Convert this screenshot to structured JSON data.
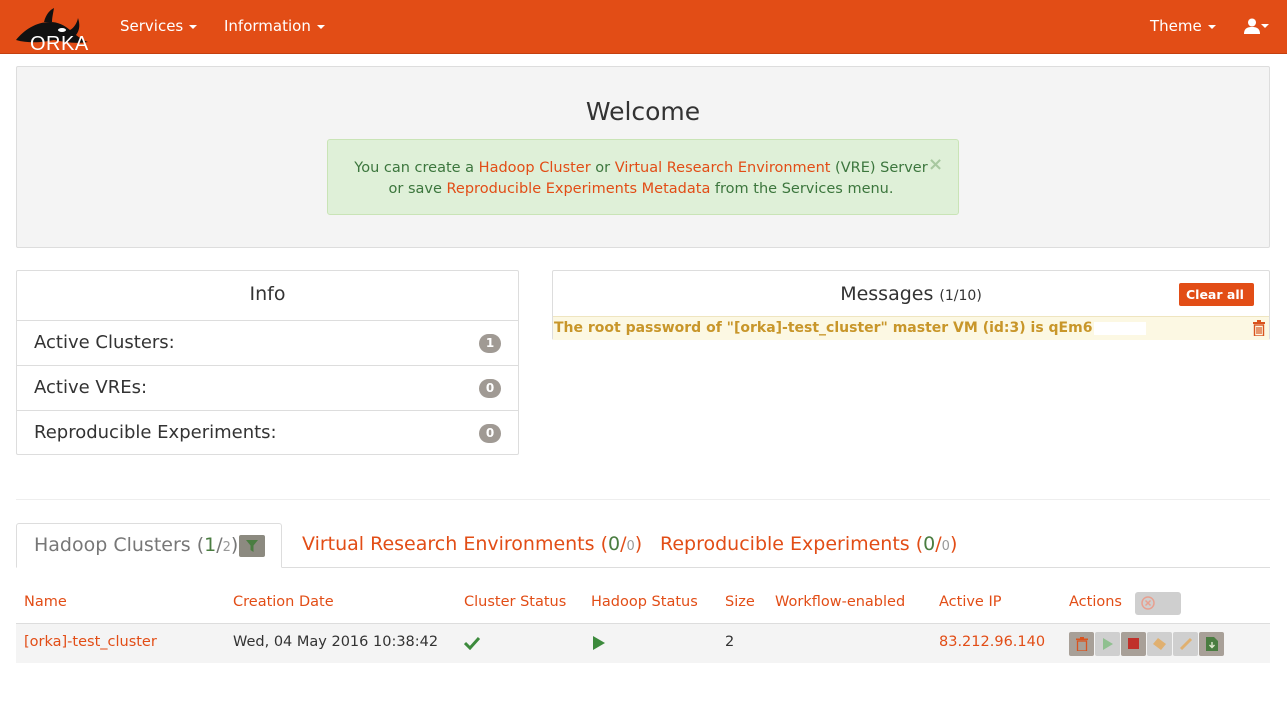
{
  "navbar": {
    "logo_text": "ORKA",
    "services_label": "Services",
    "information_label": "Information",
    "theme_label": "Theme"
  },
  "welcome": {
    "title": "Welcome",
    "alert_part1": "You can create a ",
    "alert_link1": "Hadoop Cluster",
    "alert_part2": " or ",
    "alert_link2": "Virtual Research Environment",
    "alert_part3": " (VRE) Server",
    "alert_part4": "or save ",
    "alert_link3": "Reproducible Experiments Metadata",
    "alert_part5": " from the Services menu.",
    "close_glyph": "×"
  },
  "info": {
    "title": "Info",
    "rows": [
      {
        "label": "Active Clusters:",
        "count": "1"
      },
      {
        "label": "Active VREs:",
        "count": "0"
      },
      {
        "label": "Reproducible Experiments:",
        "count": "0"
      }
    ]
  },
  "messages": {
    "title": "Messages",
    "count": "(1/10)",
    "clear_label": "Clear all",
    "items": [
      {
        "text": "The root password of \"[orka]-test_cluster\" master VM (id:3) is qEm6"
      }
    ]
  },
  "tabs": [
    {
      "label": "Hadoop Clusters (",
      "active": "1",
      "sep": "/",
      "total": "2",
      "close": ")"
    },
    {
      "label": "Virtual Research Environments (",
      "active": "0",
      "sep": "/",
      "total": "0",
      "close": ")"
    },
    {
      "label": "Reproducible Experiments (",
      "active": "0",
      "sep": "/",
      "total": "0",
      "close": ")"
    }
  ],
  "table": {
    "columns": [
      "Name",
      "Creation Date",
      "Cluster Status",
      "Hadoop Status",
      "Size",
      "Workflow-enabled",
      "Active IP",
      "Actions"
    ],
    "rows": [
      {
        "name": "[orka]-test_cluster",
        "creation_date": "Wed, 04 May 2016 10:38:42",
        "cluster_status": "check-icon",
        "hadoop_status": "play-icon",
        "size": "2",
        "workflow_enabled": "",
        "active_ip": "83.212.96.140"
      }
    ]
  },
  "colors": {
    "brand": "#e24d16",
    "success": "#3c763d",
    "warning_text": "#c8962a"
  }
}
